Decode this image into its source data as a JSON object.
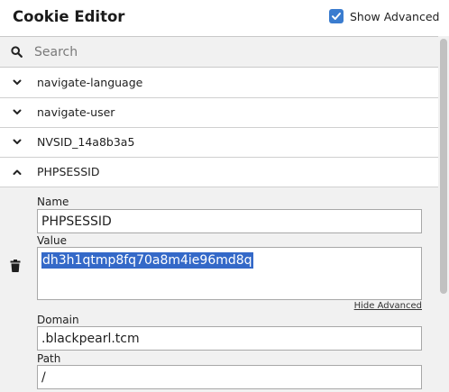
{
  "app": {
    "title": "Cookie Editor",
    "show_advanced_label": "Show Advanced",
    "show_advanced_checked": true
  },
  "search": {
    "placeholder": "Search"
  },
  "cookies": [
    {
      "name": "navigate-language",
      "expanded": false
    },
    {
      "name": "navigate-user",
      "expanded": false
    },
    {
      "name": "NVSID_14a8b3a5",
      "expanded": false
    },
    {
      "name": "PHPSESSID",
      "expanded": true
    }
  ],
  "details": {
    "name_label": "Name",
    "name_value": "PHPSESSID",
    "value_label": "Value",
    "value_value": "dh3h1qtmp8fq70a8m4ie96md8q",
    "hide_advanced_label": "Hide Advanced",
    "domain_label": "Domain",
    "domain_value": ".blackpearl.tcm",
    "path_label": "Path",
    "path_value": "/"
  },
  "colors": {
    "accent": "#3a7ccf",
    "selection": "#3469c8",
    "panel_bg": "#f1f1f1"
  }
}
